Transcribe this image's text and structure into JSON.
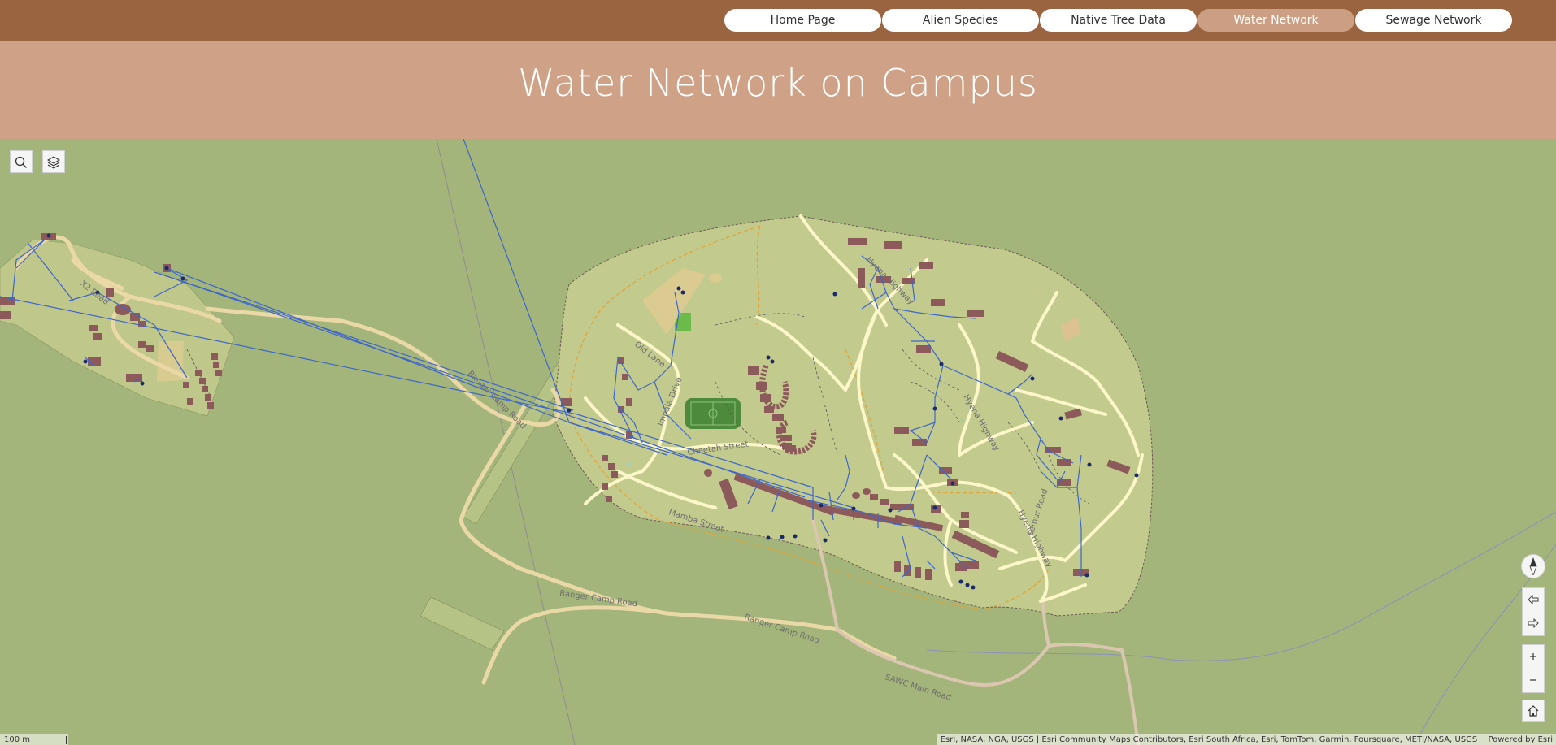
{
  "nav": {
    "tabs": [
      {
        "label": "Home Page",
        "active": false
      },
      {
        "label": "Alien Species",
        "active": false
      },
      {
        "label": "Native Tree Data",
        "active": false
      },
      {
        "label": "Water Network",
        "active": true
      },
      {
        "label": "Sewage Network",
        "active": false
      }
    ]
  },
  "header": {
    "title": "Water Network on Campus"
  },
  "map": {
    "tools": {
      "search_icon": "search-icon",
      "layers_icon": "layers-icon"
    },
    "road_labels": {
      "old_lane": "Old Lane",
      "impala_drive": "Impala Drive",
      "cheetah_street": "Cheetah Street",
      "mamba_street": "Mamba Street",
      "hyena_highway_north": "Hyena Highway",
      "hyena_highway_mid": "Hyena Highway",
      "hyena_highway_south": "Hyena Highway",
      "lemur_road": "Lemur Road",
      "ranger_camp_road_west": "Ranger Camp Road",
      "ranger_camp_road_mid": "Ranger Camp Road",
      "ranger_camp_road_east": "Ranger Camp Road",
      "sawc_main_road": "SAWC Main Road",
      "x2_road": "X2 Road"
    },
    "scale": "100 m",
    "attribution": "Esri, NASA, NGA, USGS | Esri Community Maps Contributors, Esri South Africa, Esri, TomTom, Garmin, Foursquare, METI/NASA, USGS",
    "powered_by": "Powered by Esri",
    "colors": {
      "background": "#a3b57b",
      "campus": "#c3ca8e",
      "road": "#fbf7c9",
      "water_line": "#3d66c9",
      "building": "#8c5a5a"
    }
  }
}
